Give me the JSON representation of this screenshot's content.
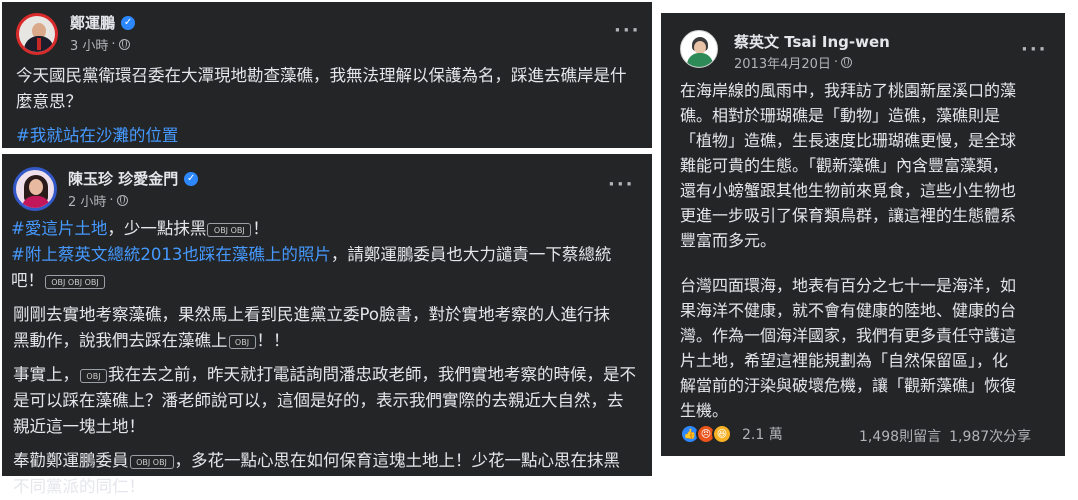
{
  "post1": {
    "author": "鄭運鵬",
    "time": "3 小時",
    "separator": "·",
    "lines": [
      "今天國民黨衛環召委在大潭現地勘查藻礁，我無法理解以保護為名，踩進去礁岸是什",
      "麼意思？"
    ],
    "hashtag": "#我就站在沙灘的位置"
  },
  "post2": {
    "author": "陳玉珍 珍愛金門",
    "time": "2 小時",
    "separator": "·",
    "p1_tag1": "#愛這片土地",
    "p1_text1": "，少一點抹黑",
    "p1_end1": "！",
    "p1_tag2": "#附上蔡英文總統2013也踩在藻礁上的照片",
    "p1_text2": "，請鄭運鵬委員也大力譴責一下蔡總統",
    "p1_text3": "吧！",
    "p2_line1": "剛剛去實地考察藻礁，果然馬上看到民進黨立委Po臉書，對於實地考察的人進行抹",
    "p2_line2": "黑動作，說我們去踩在藻礁上",
    "p2_end": "！！",
    "p3_start": "事實上，",
    "p3_line1": "我在去之前，昨天就打電話詢問潘忠政老師，我們實地考察的時候，是不",
    "p3_line2": "是可以踩在藻礁上？潘老師說可以，這個是好的，表示我們實際的去親近大自然，去",
    "p3_line3": "親近這一塊土地！",
    "p4_start": "奉勸鄭運鵬委員",
    "p4_line1": "，多花一點心思在如何保育這塊土地上！少花一點心思在抹黑",
    "p4_line2": "不同黨派的同仁！",
    "emoji_label": "OBJ"
  },
  "post3": {
    "author": "蔡英文 Tsai Ing-wen",
    "date": "2013年4月20日",
    "separator": "·",
    "para1": [
      "在海岸線的風雨中，我拜訪了桃園新屋溪口的藻",
      "礁。相對於珊瑚礁是「動物」造礁，藻礁則是",
      "「植物」造礁，生長速度比珊瑚礁更慢，是全球",
      "難能可貴的生態。「觀新藻礁」內含豐富藻類，",
      "還有小螃蟹跟其他生物前來覓食，這些小生物也",
      "更進一步吸引了保育類鳥群，讓這裡的生態體系",
      "豐富而多元。"
    ],
    "para2": [
      "台灣四面環海，地表有百分之七十一是海洋，如",
      "果海洋不健康，就不會有健康的陸地、健康的台",
      "灣。作為一個海洋國家，我們有更多責任守護這",
      "片土地，希望這裡能規劃為「自然保留區」，化",
      "解當前的汙染與破壞危機，讓「觀新藻礁」恢復",
      "生機。"
    ],
    "reactions_count": "2.1 萬",
    "comments": "1,498則留言",
    "shares": "1,987次分享"
  },
  "icons": {
    "verified": "verified-badge-icon",
    "globe": "globe-icon",
    "more": "more-options-icon"
  },
  "colors": {
    "card_bg": "#242526",
    "text": "#e4e6eb",
    "secondary": "#b0b3b8",
    "link": "#4599ff",
    "verified": "#2d88ff"
  }
}
